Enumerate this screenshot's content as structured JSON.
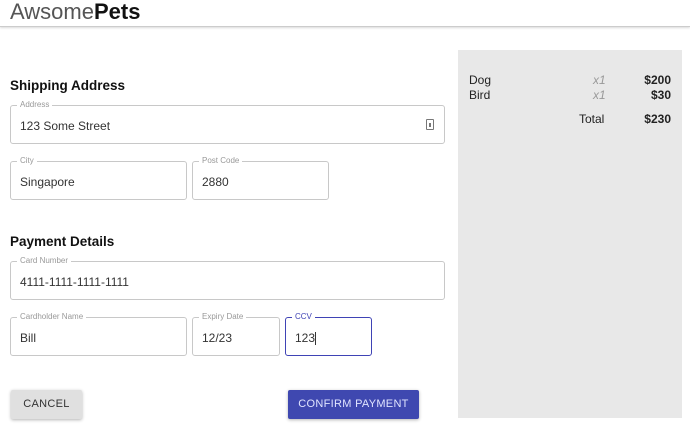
{
  "header": {
    "logo_light": "Awsome",
    "logo_bold": "Pets"
  },
  "shipping": {
    "title": "Shipping Address",
    "address": {
      "label": "Address",
      "value": "123 Some Street"
    },
    "city": {
      "label": "City",
      "value": "Singapore"
    },
    "postcode": {
      "label": "Post Code",
      "value": "2880"
    }
  },
  "payment": {
    "title": "Payment Details",
    "card": {
      "label": "Card Number",
      "value": "4111-1111-1111-1111"
    },
    "name": {
      "label": "Cardholder Name",
      "value": "Bill"
    },
    "expiry": {
      "label": "Expiry Date",
      "value": "12/23"
    },
    "ccv": {
      "label": "CCV",
      "value": "123"
    }
  },
  "buttons": {
    "cancel": "CANCEL",
    "confirm": "CONFIRM PAYMENT"
  },
  "summary": {
    "items": [
      {
        "name": "Dog",
        "qty": "x1",
        "price": "$200"
      },
      {
        "name": "Bird",
        "qty": "x1",
        "price": "$30"
      }
    ],
    "total_label": "Total",
    "total": "$230"
  }
}
